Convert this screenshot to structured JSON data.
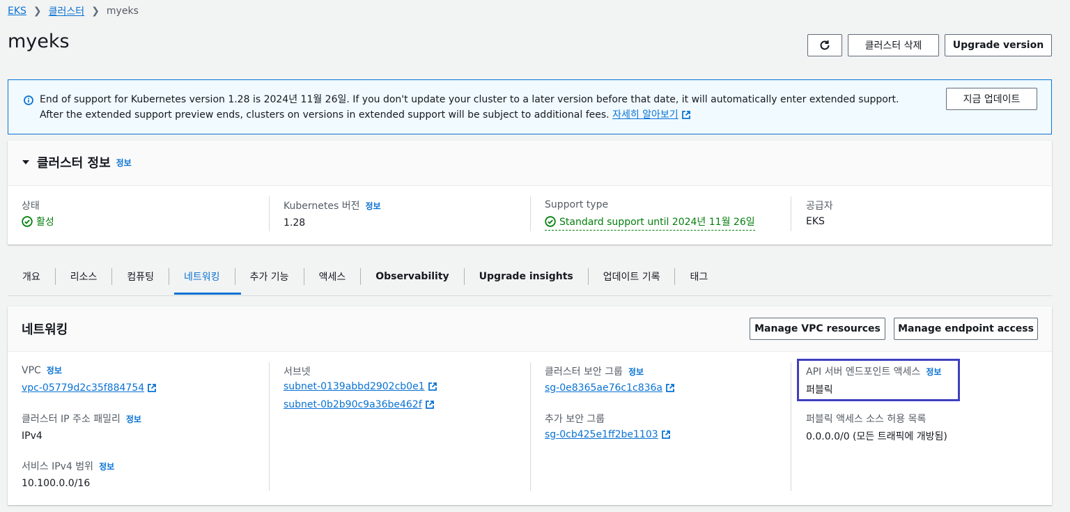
{
  "breadcrumb": {
    "root": "EKS",
    "clusters": "클러스터",
    "current": "myeks"
  },
  "page_title": "myeks",
  "header_buttons": {
    "delete": "클러스터 삭제",
    "upgrade": "Upgrade version"
  },
  "banner": {
    "message": "End of support for Kubernetes version 1.28 is 2024년 11월 26일. If you don't update your cluster to a later version before that date, it will automatically enter extended support. After the extended support preview ends, clusters on versions in extended support will be subject to additional fees.",
    "learn_more": "자세히 알아보기",
    "update_now": "지금 업데이트"
  },
  "cluster_info": {
    "title": "클러스터 정보",
    "info": "정보",
    "status_label": "상태",
    "status_value": "활성",
    "k8s_label": "Kubernetes 버전",
    "k8s_info": "정보",
    "k8s_value": "1.28",
    "support_label": "Support type",
    "support_value": "Standard support until 2024년 11월 26일",
    "provider_label": "공급자",
    "provider_value": "EKS"
  },
  "tabs": [
    "개요",
    "리소스",
    "컴퓨팅",
    "네트워킹",
    "추가 기능",
    "액세스",
    "Observability",
    "Upgrade insights",
    "업데이트 기록",
    "태그"
  ],
  "networking": {
    "title": "네트워킹",
    "manage_vpc": "Manage VPC resources",
    "manage_endpoint": "Manage endpoint access",
    "info": "정보",
    "vpc_label": "VPC",
    "vpc_value": "vpc-05779d2c35f884754",
    "ip_family_label": "클러스터 IP 주소 패밀리",
    "ip_family_value": "IPv4",
    "svc_range_label": "서비스 IPv4 범위",
    "svc_range_value": "10.100.0.0/16",
    "subnets_label": "서브넷",
    "subnet1": "subnet-0139abbd2902cb0e1",
    "subnet2": "subnet-0b2b90c9a36be462f",
    "cluster_sg_label": "클러스터 보안 그룹",
    "cluster_sg_value": "sg-0e8365ae76c1c836a",
    "add_sg_label": "추가 보안 그룹",
    "add_sg_value": "sg-0cb425e1ff2be1103",
    "api_access_label": "API 서버 엔드포인트 액세스",
    "api_access_value": "퍼블릭",
    "allowlist_label": "퍼블릭 액세스 소스 허용 목록",
    "allowlist_value": "0.0.0.0/0 (모든 트래픽에 개방됨)"
  },
  "colors": {
    "link": "#0972d3",
    "success": "#037f0c",
    "highlight": "#3f3fbf"
  }
}
